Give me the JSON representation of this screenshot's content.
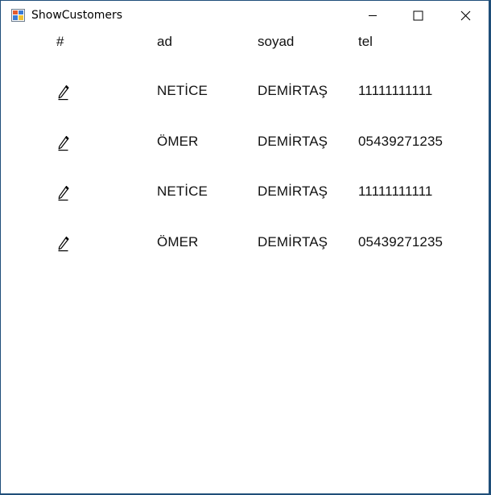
{
  "window": {
    "title": "ShowCustomers",
    "icon": "winforms-app-icon",
    "controls": {
      "minimize_icon": "minimize-icon",
      "maximize_icon": "maximize-icon",
      "close_icon": "close-icon"
    }
  },
  "table": {
    "columns": {
      "hash": "#",
      "ad": "ad",
      "soyad": "soyad",
      "tel": "tel"
    },
    "rows": [
      {
        "edit_icon": "pencil-edit-icon",
        "ad": "NETİCE",
        "soyad": "DEMİRTAŞ",
        "tel": "11111111111"
      },
      {
        "edit_icon": "pencil-edit-icon",
        "ad": "ÖMER",
        "soyad": "DEMİRTAŞ",
        "tel": "05439271235"
      },
      {
        "edit_icon": "pencil-edit-icon",
        "ad": "NETİCE",
        "soyad": "DEMİRTAŞ",
        "tel": "11111111111"
      },
      {
        "edit_icon": "pencil-edit-icon",
        "ad": "ÖMER",
        "soyad": "DEMİRTAŞ",
        "tel": "05439271235"
      }
    ]
  }
}
